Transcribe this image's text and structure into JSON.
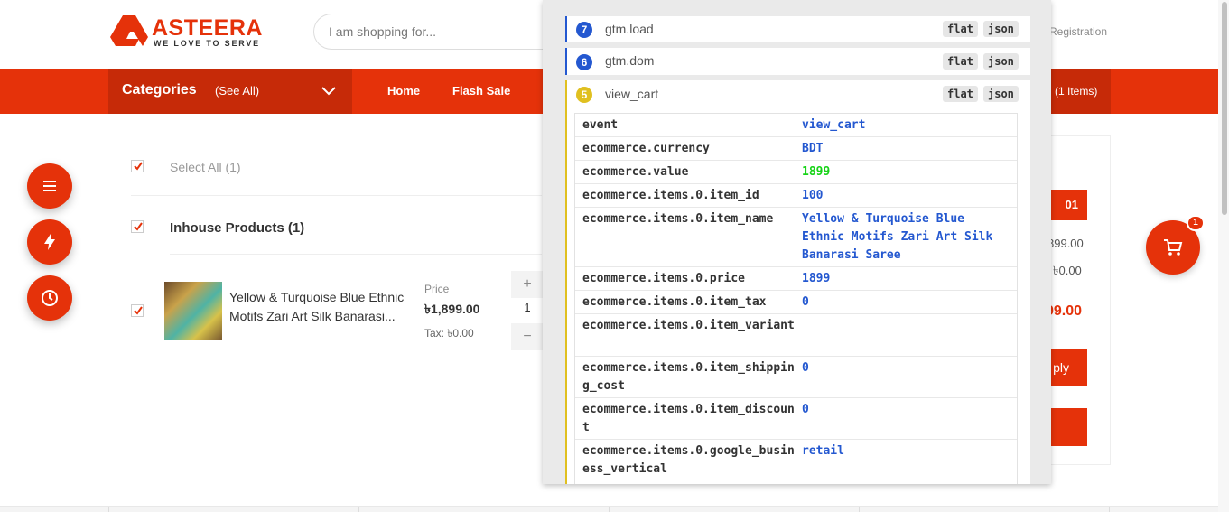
{
  "header": {
    "logo_name": "ASTEERA",
    "logo_tagline": "WE LOVE TO SERVE",
    "search_placeholder": "I am shopping for...",
    "registration_label": "Registration"
  },
  "nav": {
    "categories_label": "Categories",
    "see_all_label": "(See All)",
    "links": [
      "Home",
      "Flash Sale"
    ],
    "cart_items_label": "(1 Items)"
  },
  "cart": {
    "select_all_label": "Select All (1)",
    "section_title": "Inhouse Products (1)",
    "product": {
      "name": "Yellow & Turquoise Blue Ethnic Motifs Zari Art Silk Banarasi...",
      "price_label": "Price",
      "price": "৳1,899.00",
      "tax": "Tax: ৳0.00",
      "quantity": "1",
      "plus": "+",
      "minus": "−"
    }
  },
  "summary": {
    "badge": "01",
    "subtotal": "899.00",
    "tax": "৳0.00",
    "total": "99.00",
    "apply_label": "ply"
  },
  "floating_cart": {
    "count": "1"
  },
  "gtm": {
    "events": [
      {
        "number": "7",
        "name": "gtm.load",
        "color": "#2458d0"
      },
      {
        "number": "6",
        "name": "gtm.dom",
        "color": "#2458d0"
      },
      {
        "number": "5",
        "name": "view_cart",
        "color": "#e0c020"
      }
    ],
    "flat_label": "flat",
    "json_label": "json",
    "rows": [
      {
        "key": "event",
        "value": "view_cart",
        "style": "text"
      },
      {
        "key": "ecommerce.currency",
        "value": "BDT",
        "style": "text"
      },
      {
        "key": "ecommerce.value",
        "value": "1899",
        "style": "green"
      },
      {
        "key": "ecommerce.items.0.item_id",
        "value": "100",
        "style": "text"
      },
      {
        "key": "ecommerce.items.0.item_name",
        "value": "Yellow & Turquoise Blue Ethnic Motifs Zari Art Silk Banarasi Saree",
        "style": "text"
      },
      {
        "key": "ecommerce.items.0.price",
        "value": "1899",
        "style": "text"
      },
      {
        "key": "ecommerce.items.0.item_tax",
        "value": "0",
        "style": "text"
      },
      {
        "key": "ecommerce.items.0.item_variant",
        "value": "",
        "style": "text"
      },
      {
        "key": "ecommerce.items.0.item_shipping_cost",
        "value": "0",
        "style": "text"
      },
      {
        "key": "ecommerce.items.0.item_discount",
        "value": "0",
        "style": "text"
      },
      {
        "key": "ecommerce.items.0.google_business_vertical",
        "value": "retail",
        "style": "text"
      }
    ]
  },
  "colors": {
    "brand": "#e5320a",
    "brand_dark": "#c62a08",
    "gtm_key": "#333333",
    "gtm_value": "#2458d0",
    "gtm_green": "#18d318"
  }
}
